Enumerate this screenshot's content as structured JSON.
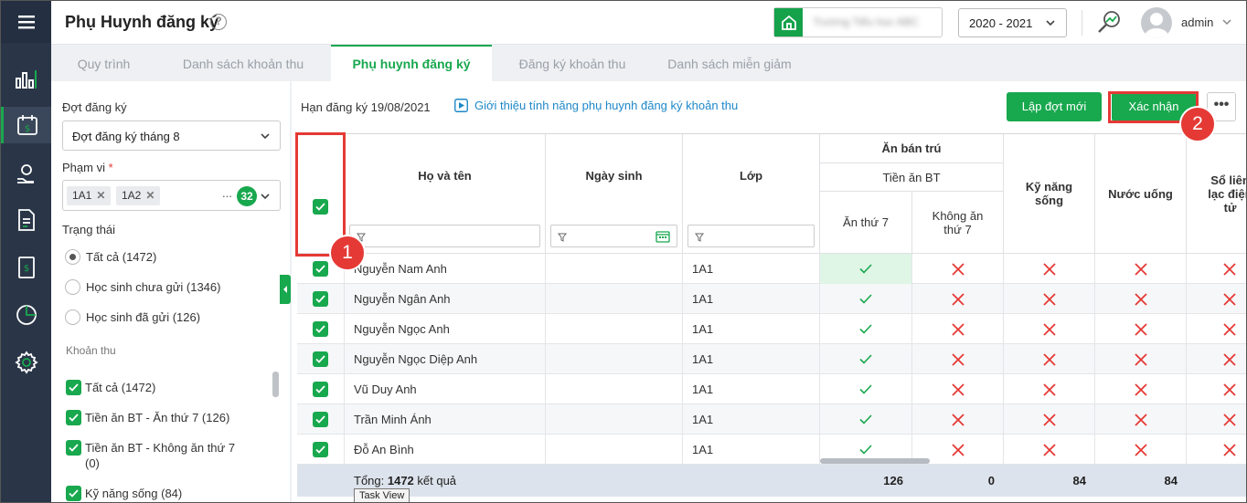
{
  "header": {
    "title": "Phụ Huynh đăng ký",
    "help_icon": "question-circle-icon",
    "school_name": "Trường Tiểu học ABC",
    "school_year": "2020 - 2021",
    "username": "admin"
  },
  "tabs": [
    {
      "label": "Quy trình"
    },
    {
      "label": "Danh sách khoản thu"
    },
    {
      "label": "Phụ huynh đăng ký"
    },
    {
      "label": "Đăng ký khoản thu"
    },
    {
      "label": "Danh sách miễn giảm"
    }
  ],
  "active_tab": "Phụ huynh đăng ký",
  "filters": {
    "period_label": "Đợt đăng ký",
    "period_value": "Đợt đăng ký tháng 8",
    "scope_label": "Phạm vi",
    "scope_required": "*",
    "scope_chips": [
      "1A1",
      "1A2"
    ],
    "scope_more": "...",
    "scope_count": "32",
    "status_label": "Trạng thái",
    "status_options": [
      {
        "label": "Tất cả (1472)",
        "selected": true
      },
      {
        "label": "Học sinh chưa gửi (1346)",
        "selected": false
      },
      {
        "label": "Học sinh đã gửi (126)",
        "selected": false
      }
    ],
    "fees_label": "Khoản thu",
    "fee_options": [
      {
        "label": "Tất cả (1472)",
        "checked": true
      },
      {
        "label": "Tiền ăn BT - Ăn thứ 7 (126)",
        "checked": true
      },
      {
        "label": "Tiền ăn BT - Không ăn thứ 7 (0)",
        "checked": true
      },
      {
        "label": "Kỹ năng sống (84)",
        "checked": true
      }
    ]
  },
  "toolbar": {
    "deadline": "Hạn đăng ký 19/08/2021",
    "intro_link": "Giới thiệu tính năng phụ huynh đăng ký khoản thu",
    "new_period_button": "Lập đợt mới",
    "confirm_button": "Xác nhận",
    "more_button": "•••"
  },
  "table": {
    "headers": {
      "name": "Họ và tên",
      "dob": "Ngày sinh",
      "class": "Lớp",
      "group_meal": "Ăn bán trú",
      "sub_meal": "Tiền ăn BT",
      "meal_sat": "Ăn thứ 7",
      "meal_no_sat": "Không ăn thứ 7",
      "life_skills": "Kỹ năng sống",
      "water": "Nước uống",
      "contact_book": "Sổ liên lạc điện tử"
    },
    "rows": [
      {
        "name": "Nguyễn Nam Anh",
        "dob": "",
        "class": "1A1",
        "meal_sat": true,
        "meal_no_sat": false,
        "life_skills": false,
        "water": false
      },
      {
        "name": "Nguyễn Ngân Anh",
        "dob": "",
        "class": "1A1",
        "meal_sat": true,
        "meal_no_sat": false,
        "life_skills": false,
        "water": false
      },
      {
        "name": "Nguyễn Ngọc Anh",
        "dob": "",
        "class": "1A1",
        "meal_sat": true,
        "meal_no_sat": false,
        "life_skills": false,
        "water": false
      },
      {
        "name": "Nguyễn Ngọc Diệp Anh",
        "dob": "",
        "class": "1A1",
        "meal_sat": true,
        "meal_no_sat": false,
        "life_skills": false,
        "water": false
      },
      {
        "name": "Vũ Duy Anh",
        "dob": "",
        "class": "1A1",
        "meal_sat": true,
        "meal_no_sat": false,
        "life_skills": false,
        "water": false
      },
      {
        "name": "Trần Minh Ánh",
        "dob": "",
        "class": "1A1",
        "meal_sat": true,
        "meal_no_sat": false,
        "life_skills": false,
        "water": false
      },
      {
        "name": "Đỗ An Bình",
        "dob": "",
        "class": "1A1",
        "meal_sat": true,
        "meal_no_sat": false,
        "life_skills": false,
        "water": false
      }
    ],
    "footer": {
      "total_prefix": "Tổng: ",
      "total_count": "1472",
      "total_suffix": " kết quả",
      "meal_sat": "126",
      "meal_no_sat": "0",
      "life_skills": "84",
      "water": "84"
    }
  },
  "annotations": {
    "step1": "1",
    "step2": "2"
  },
  "tooltip": "Task View",
  "colors": {
    "accent": "#18a84e",
    "annotation": "#e53935",
    "check": "#18a84e",
    "cross": "#e53935"
  }
}
